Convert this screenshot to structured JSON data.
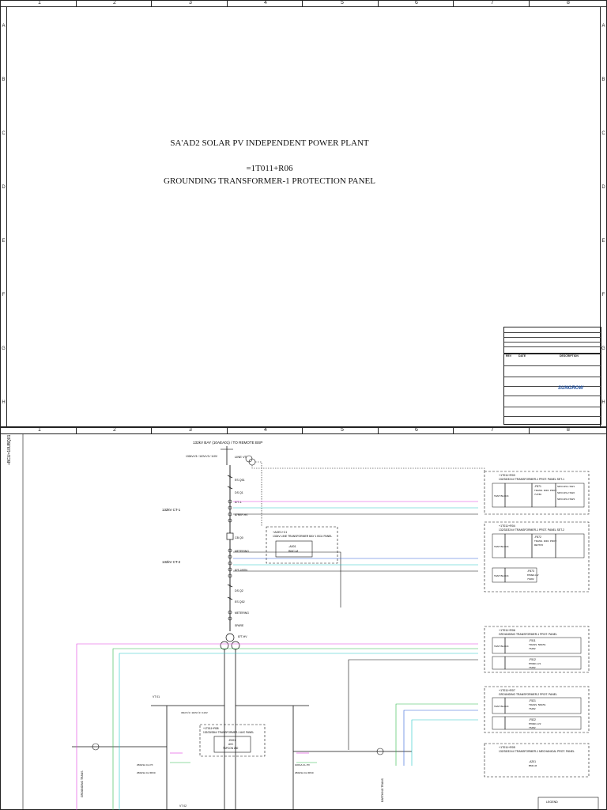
{
  "sheet1": {
    "col_numbers": [
      "1",
      "2",
      "3",
      "4",
      "5",
      "6",
      "7",
      "8"
    ],
    "row_letters": [
      "A",
      "B",
      "C",
      "D",
      "E",
      "F",
      "G",
      "H"
    ],
    "title": {
      "line1": "SA'AD2 SOLAR PV INDEPENDENT POWER PLANT",
      "line2": "=1T011+R06",
      "line3": "GROUNDING TRANSFORMER-1 PROTECTION PANEL"
    },
    "title_block": {
      "logo_text": "SUNGROW",
      "rev_col": "REV",
      "date_col": "DATE",
      "desc_col": "DESCRIPTION"
    }
  },
  "sheet2": {
    "col_numbers": [
      "1",
      "2",
      "3",
      "4",
      "5",
      "6",
      "7",
      "8"
    ],
    "bay_title": "132kV BAY (10AEA01) / TO REMOTE BSP",
    "ct1_label": "132kV CT-1",
    "ct2_label": "132kV CT-2",
    "line_vt_label": "LINE VT",
    "vt_ratio": "132kV/√3 / 110V/√3 / 110V",
    "components": {
      "ds_q1": "DS Q1",
      "es_q51": "ES Q51",
      "cb_q0": "CB Q0",
      "ds_q2": "DS Q2",
      "es_q52": "ES Q52",
      "metering": "METERING",
      "spare": "SPARE",
      "bt1": "87T-1",
      "bt1_2": "87T-2/87N",
      "bt_hv": "87REF-HV",
      "bt_hv2": "87T-HV"
    },
    "bcu_panel": {
      "title": "+AOE1+C1",
      "subtitle": "132kV LINE TRANSFORMER BAY 1 BCU PANEL",
      "device": "-A001",
      "device_type": "BMC-M"
    },
    "panel_set1": {
      "ref": "+1T011+R03",
      "title": "132/33/33 kV TRANSFORMER-1 PROT. PANEL SET-1",
      "relay": "-F871",
      "relay_desc": "TRANS. DIFF. PROT.",
      "relay_model": "7UT86",
      "test_block": "TEST BLOCK",
      "sw1": "SDV1/15-1 SW1",
      "sw2": "SDV1/15-2 SW2",
      "sw3": "SDV1/15-3 SW3"
    },
    "panel_set2": {
      "ref": "+1T011+R04",
      "title": "132/33/33 kV TRANSFORMER-1 PROT. PANEL SET-2",
      "relay": "-F872",
      "relay_desc": "TRANS. DIFF. PROT.",
      "relay_model": "RET670",
      "test_block": "TEST BLOCK",
      "relay_ref": "-F873",
      "relay_ref_desc": "87REF-HV",
      "relay_ref_model": "7SJ82"
    },
    "gt1_panel": {
      "ref": "+1T011+R06",
      "title": "GROUNDING TRANSFORMER-1 PROT. PANEL",
      "relay": "-F511",
      "relay_desc": "TRANS. 50N/51",
      "relay_model": "7SJ82",
      "relay2": "-F512",
      "relay2_desc": "87REF-LV1",
      "relay2_model": "7SJ82",
      "test_block": "TEST BLOCK"
    },
    "gt2_panel": {
      "ref": "+1T011+R07",
      "title": "GROUNDING TRANSFORMER-2 PROT. PANEL",
      "relay": "-F521",
      "relay_desc": "TRANS. 50N/51",
      "relay_model": "7SJ82",
      "relay2": "-F522",
      "relay2_desc": "87REF-LV2",
      "relay2_model": "7SJ82",
      "test_block": "TEST BLOCK"
    },
    "mech_panel": {
      "ref": "+1T011+R05",
      "title": "132/33/33 kV TRANSFORMER-1 MECHANICAL PROT. PANEL",
      "device": "-A201",
      "device_type": "BMC-M"
    },
    "avc_panel": {
      "ref": "+1T011+R08",
      "title": "132/33/33kV TRANSFORMER-1 AVC PANEL",
      "device": "-E001",
      "device_type": "AVC",
      "device_desc": "TAPCON 260"
    },
    "grounding_trans_left": "GROUNDING TRANS",
    "earthing_trans_right": "EARTHING TRANS",
    "legend_title": "LEGEND",
    "side_label": "+BCU=10UBQ01",
    "vt_labels": {
      "vt01": "VT 01",
      "vt02": "VT 02",
      "vt_ratio_33": "33kV/√3 / 110V/√3 / 110V"
    },
    "mv_cts": {
      "c1": "2500/1A CL.PX",
      "c2": "2500/1A CL.5P20",
      "c3": "100/1A CL.PX",
      "c4": "2500/1A CL.5P20"
    },
    "colors": {
      "magenta": "#e03ce0",
      "cyan": "#22c8c8",
      "green": "#2db84a",
      "blue": "#3060d8",
      "black": "#111111"
    }
  }
}
